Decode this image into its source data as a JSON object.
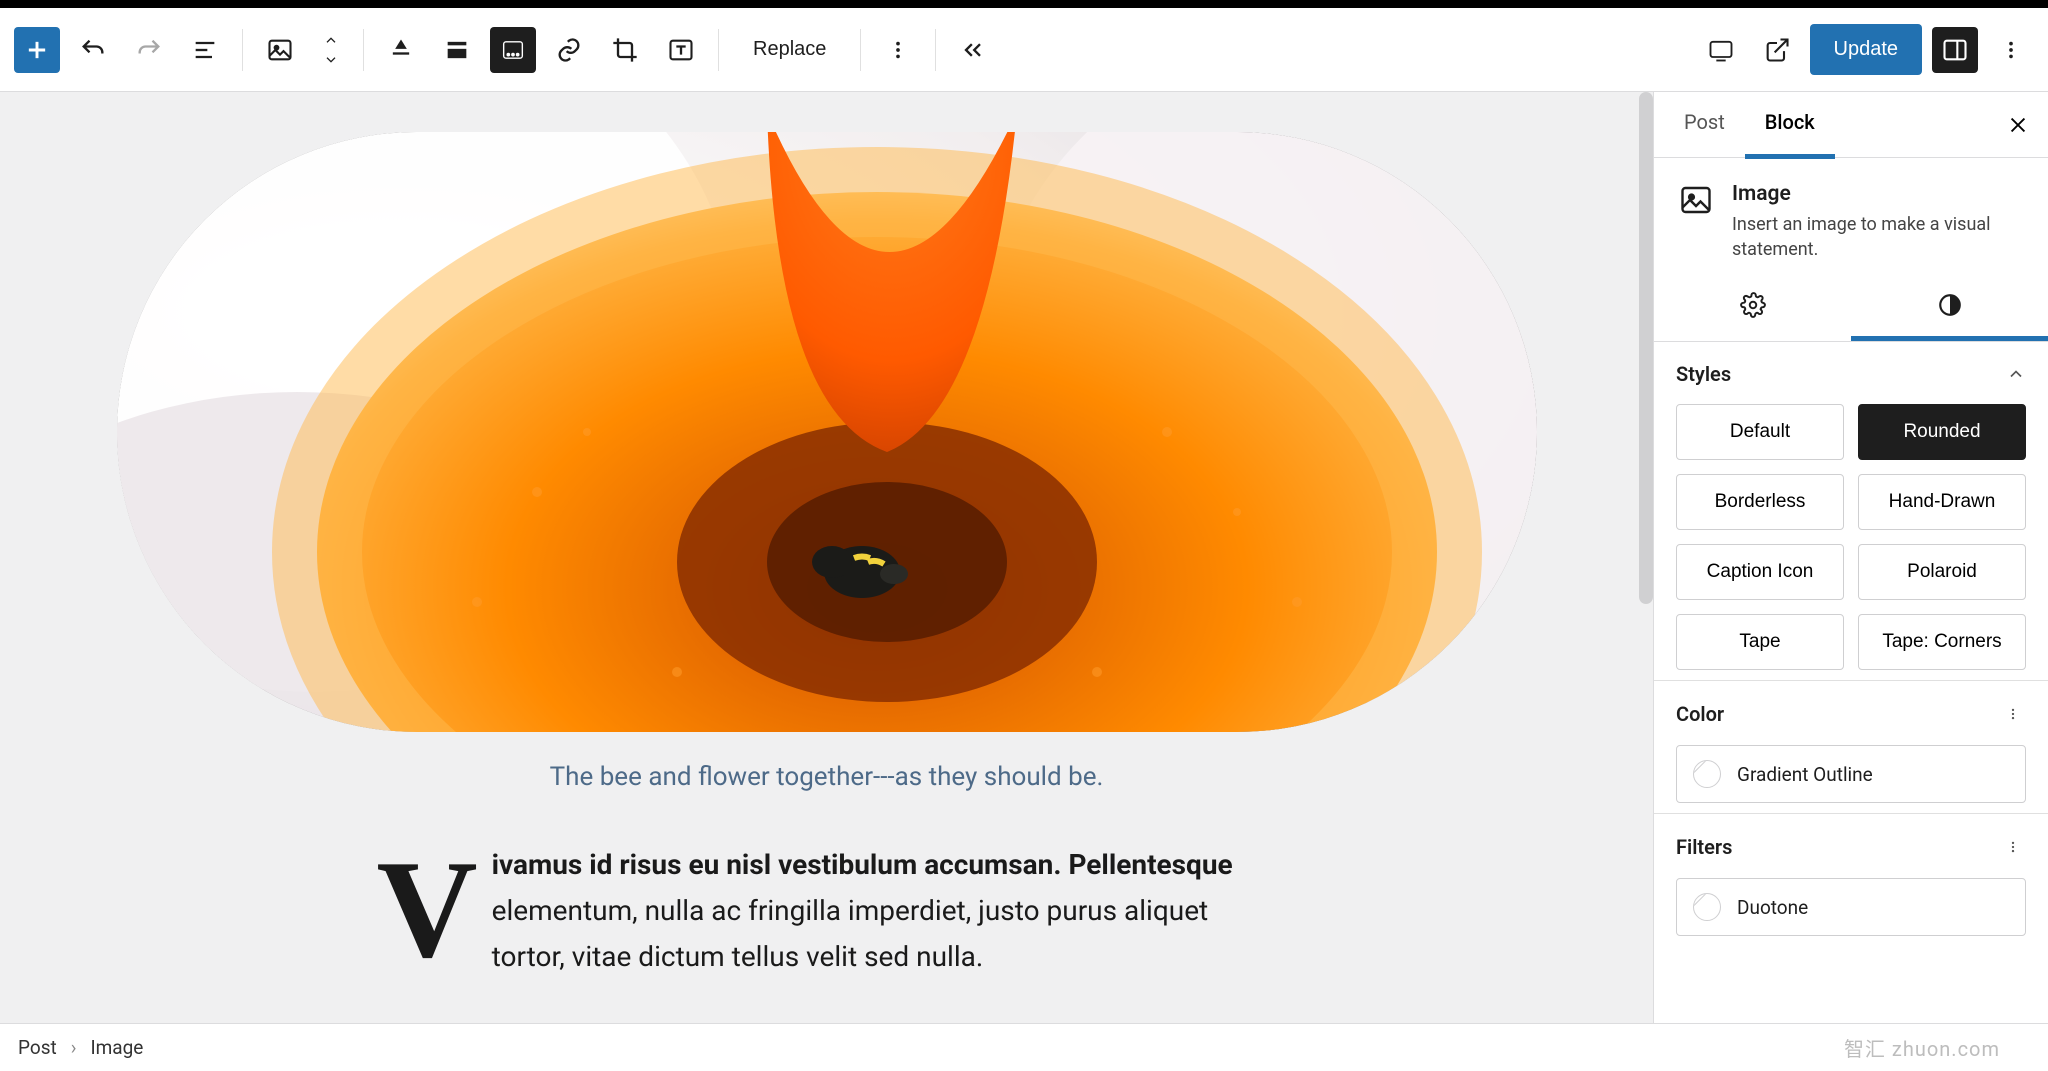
{
  "toolbar": {
    "replace_label": "Replace",
    "update_label": "Update"
  },
  "sidebar": {
    "tabs": {
      "post": "Post",
      "block": "Block"
    },
    "block": {
      "title": "Image",
      "desc": "Insert an image to make a visual statement."
    },
    "styles": {
      "heading": "Styles",
      "options": [
        "Default",
        "Rounded",
        "Borderless",
        "Hand-Drawn",
        "Caption Icon",
        "Polaroid",
        "Tape",
        "Tape: Corners"
      ],
      "selected": "Rounded"
    },
    "color": {
      "heading": "Color",
      "item": "Gradient Outline"
    },
    "filters": {
      "heading": "Filters",
      "item": "Duotone"
    }
  },
  "content": {
    "caption": "The bee and flower together---as they should be.",
    "dropcap": "V",
    "para_bold": "ivamus id risus eu nisl vestibulum accumsan. Pellentesque",
    "para_rest": " elementum, nulla ac fringilla imperdiet, justo purus aliquet tortor, vitae dictum tellus velit sed nulla."
  },
  "breadcrumb": {
    "root": "Post",
    "leaf": "Image"
  },
  "watermark": "智汇 zhuon.com"
}
